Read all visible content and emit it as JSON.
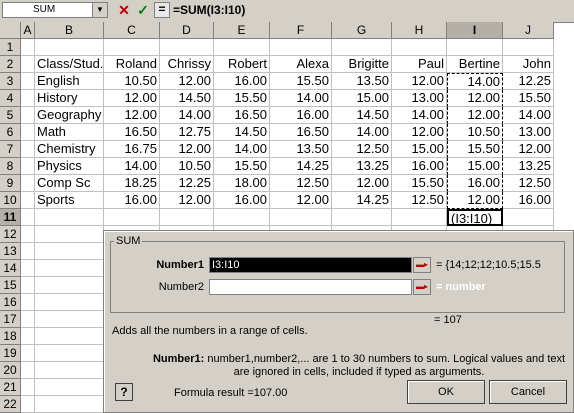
{
  "formula_bar": {
    "name_box": "SUM",
    "cancel_icon": "✕",
    "enter_icon": "✓",
    "equal_icon": "=",
    "formula": "=SUM(I3:I10)"
  },
  "columns": [
    "A",
    "B",
    "C",
    "D",
    "E",
    "F",
    "G",
    "H",
    "I",
    "J"
  ],
  "rows": [
    "1",
    "2",
    "3",
    "4",
    "5",
    "6",
    "7",
    "8",
    "9",
    "10",
    "11",
    "12",
    "13",
    "14",
    "15",
    "16",
    "17",
    "18",
    "19",
    "20",
    "21",
    "22"
  ],
  "table": {
    "header": [
      "Class/Stud.",
      "Roland",
      "Chrissy",
      "Robert",
      "Alexa",
      "Brigitte",
      "Paul",
      "Bertine",
      "John"
    ],
    "data": [
      [
        "English",
        "10.50",
        "12.00",
        "16.00",
        "15.50",
        "13.50",
        "12.00",
        "14.00",
        "12.25"
      ],
      [
        "History",
        "12.00",
        "14.50",
        "15.50",
        "14.00",
        "15.00",
        "13.00",
        "12.00",
        "15.50"
      ],
      [
        "Geography",
        "12.00",
        "14.00",
        "16.50",
        "16.00",
        "14.50",
        "14.00",
        "12.00",
        "14.00"
      ],
      [
        "Math",
        "16.50",
        "12.75",
        "14.50",
        "16.50",
        "14.00",
        "12.00",
        "10.50",
        "13.00"
      ],
      [
        "Chemistry",
        "16.75",
        "12.00",
        "14.00",
        "13.50",
        "12.50",
        "15.00",
        "15.50",
        "12.00"
      ],
      [
        "Physics",
        "14.00",
        "10.50",
        "15.50",
        "14.25",
        "13.25",
        "16.00",
        "15.00",
        "13.25"
      ],
      [
        "Comp Sc",
        "18.25",
        "12.25",
        "18.00",
        "12.50",
        "12.00",
        "15.50",
        "16.00",
        "12.50"
      ],
      [
        "Sports",
        "16.00",
        "12.00",
        "16.00",
        "12.00",
        "14.25",
        "12.50",
        "12.00",
        "16.00"
      ]
    ],
    "active_cell_text": "(I3:I10)"
  },
  "dialog": {
    "group_title": "SUM",
    "number1_label": "Number1",
    "number1_value": "I3:I10",
    "number1_result": "= {14;12;12;10.5;15.5",
    "number2_label": "Number2",
    "number2_value": "",
    "number2_result": "= number",
    "result_line": "= 107",
    "description": "Adds all the numbers in a range of cells.",
    "help_label": "Number1:",
    "help_text": "number1,number2,... are 1 to 30 numbers to sum. Logical values and text are ignored in cells, included if typed as arguments.",
    "help_button": "?",
    "formula_result": "Formula result =107.00",
    "ok_label": "OK",
    "cancel_label": "Cancel"
  }
}
